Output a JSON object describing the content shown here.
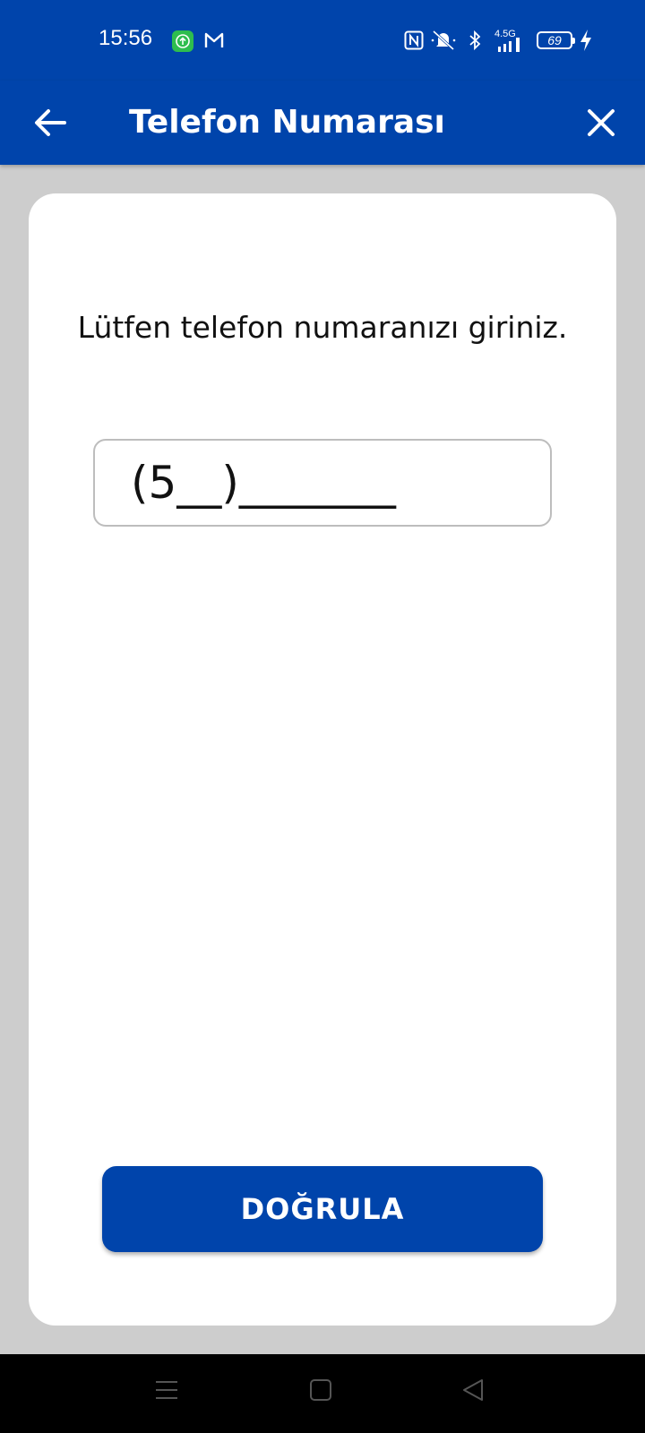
{
  "status_bar": {
    "time": "15:56",
    "network_label": "4.5G",
    "battery_level": "69",
    "icons": [
      "upload-app-icon",
      "gmail-icon",
      "nfc-icon",
      "mute-icon",
      "bluetooth-icon",
      "signal-icon",
      "battery-icon",
      "charging-icon"
    ]
  },
  "app_bar": {
    "title": "Telefon Numarası",
    "back_icon": "arrow-left-icon",
    "close_icon": "close-icon"
  },
  "form": {
    "prompt": "Lütfen telefon numaranızı giriniz.",
    "phone_value": "(5__)_______"
  },
  "actions": {
    "verify_label": "DOĞRULA"
  },
  "nav_bar": {
    "icons": [
      "menu-icon",
      "home-icon",
      "back-icon"
    ]
  },
  "colors": {
    "primary": "#0044ab",
    "background": "#cdcdcd",
    "card": "#ffffff"
  }
}
